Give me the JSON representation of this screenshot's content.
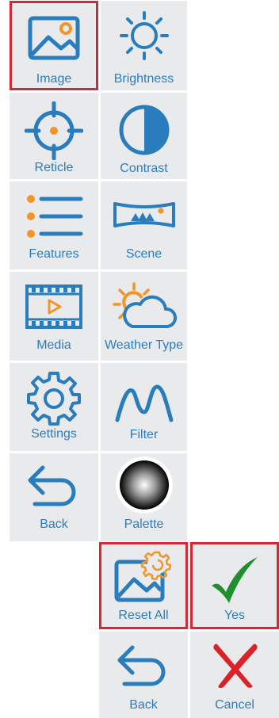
{
  "menu": {
    "image": "Image",
    "brightness": "Brightness",
    "reticle": "Reticle",
    "contrast": "Contrast",
    "features": "Features",
    "scene": "Scene",
    "media": "Media",
    "weather_type": "Weather Type",
    "settings": "Settings",
    "filter": "Filter",
    "back": "Back",
    "palette": "Palette"
  },
  "confirm": {
    "reset_all": "Reset All",
    "yes": "Yes",
    "back": "Back",
    "cancel": "Cancel"
  },
  "colors": {
    "accent_blue": "#2a7dbd",
    "accent_orange": "#f0952a",
    "tile_bg": "#e9eaeb",
    "selection_red": "#d12a36",
    "yes_green": "#1f8f2d",
    "cancel_red": "#d9222a"
  },
  "icons": [
    "image-icon",
    "brightness-icon",
    "reticle-icon",
    "contrast-icon",
    "features-icon",
    "scene-icon",
    "media-icon",
    "weather-icon",
    "settings-icon",
    "filter-icon",
    "back-icon",
    "palette-icon",
    "reset-all-icon",
    "checkmark-icon",
    "cancel-x-icon"
  ]
}
